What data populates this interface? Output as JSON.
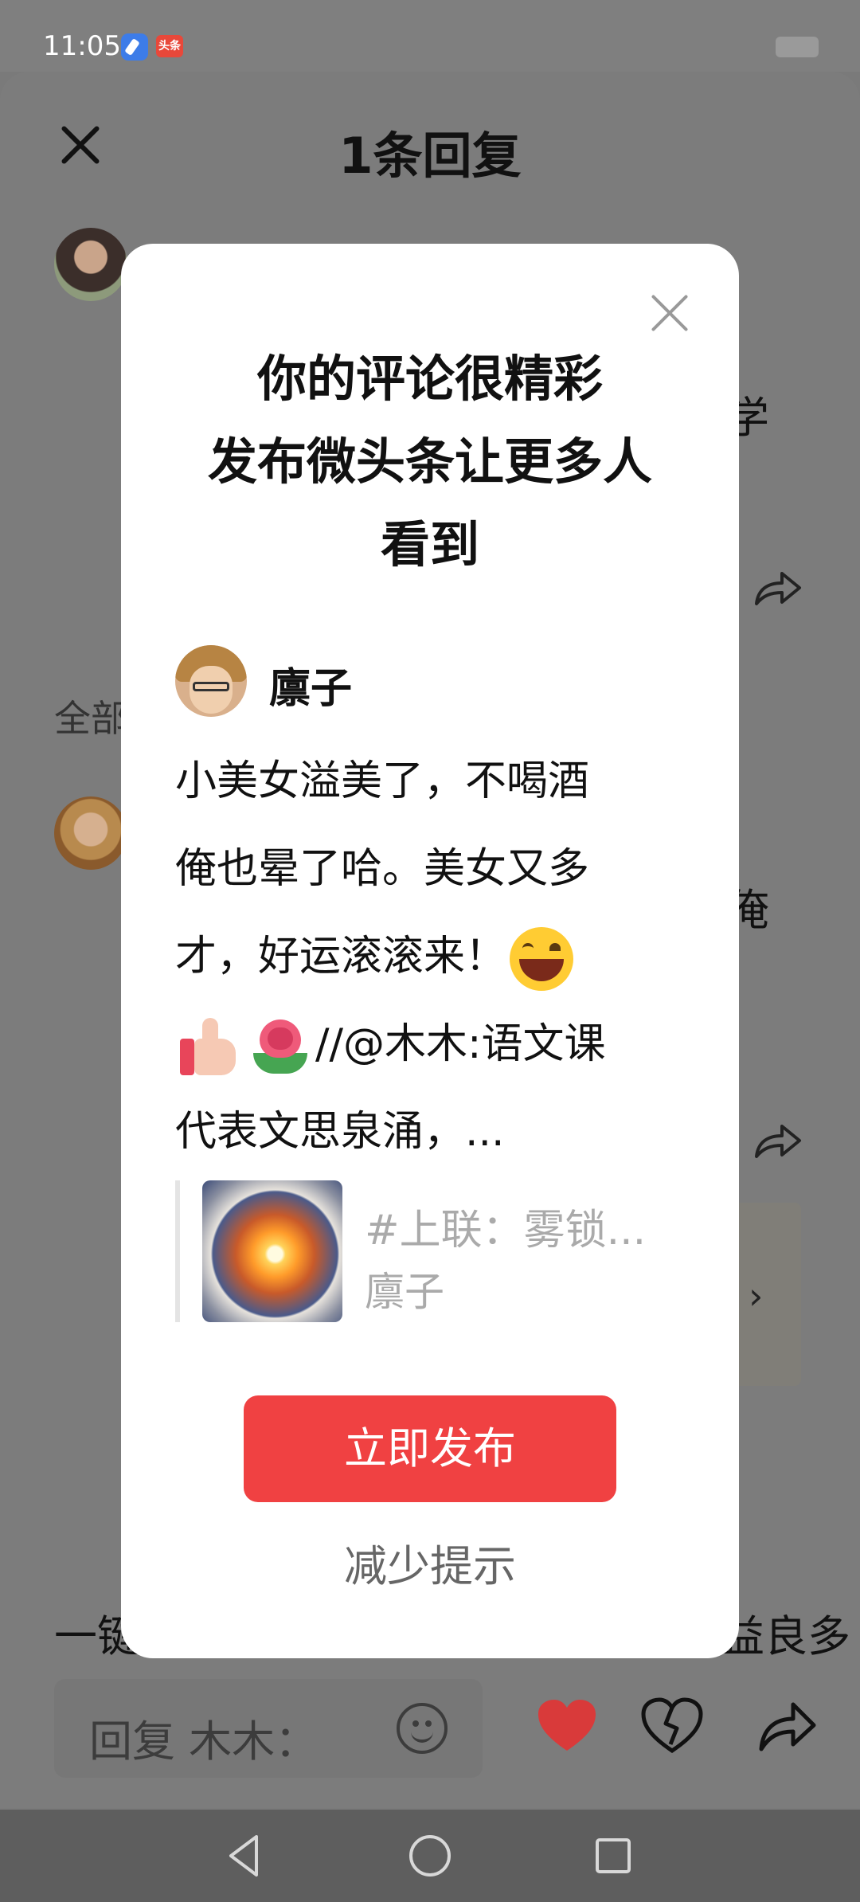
{
  "status_bar": {
    "time": "11:05",
    "app_badge": "头条"
  },
  "sheet": {
    "title": "1条回复",
    "section_label": "全部",
    "fragments": {
      "right_1": "学",
      "right_2": "俺",
      "bottom_left": "一键",
      "bottom_right": "益良多"
    }
  },
  "reply_bar": {
    "placeholder": "回复 木木："
  },
  "dialog": {
    "title_lines": [
      "你的评论很精彩",
      "发布微头条让更多人",
      "看到"
    ],
    "author": "廪子",
    "comment": {
      "line1": "小美女溢美了，不喝酒",
      "line2": "俺也晕了哈。美女又多",
      "line3": "才，好运滚滚来！",
      "line4": "//@木木:语文课",
      "line5": "代表文思泉涌，..."
    },
    "quote": {
      "title": "#上联：雾锁...",
      "author": "廪子"
    },
    "publish_label": "立即发布",
    "reduce_label": "减少提示"
  },
  "colors": {
    "accent": "#f04142",
    "like": "#d93a3a",
    "overlay": "#7c7c7c"
  }
}
